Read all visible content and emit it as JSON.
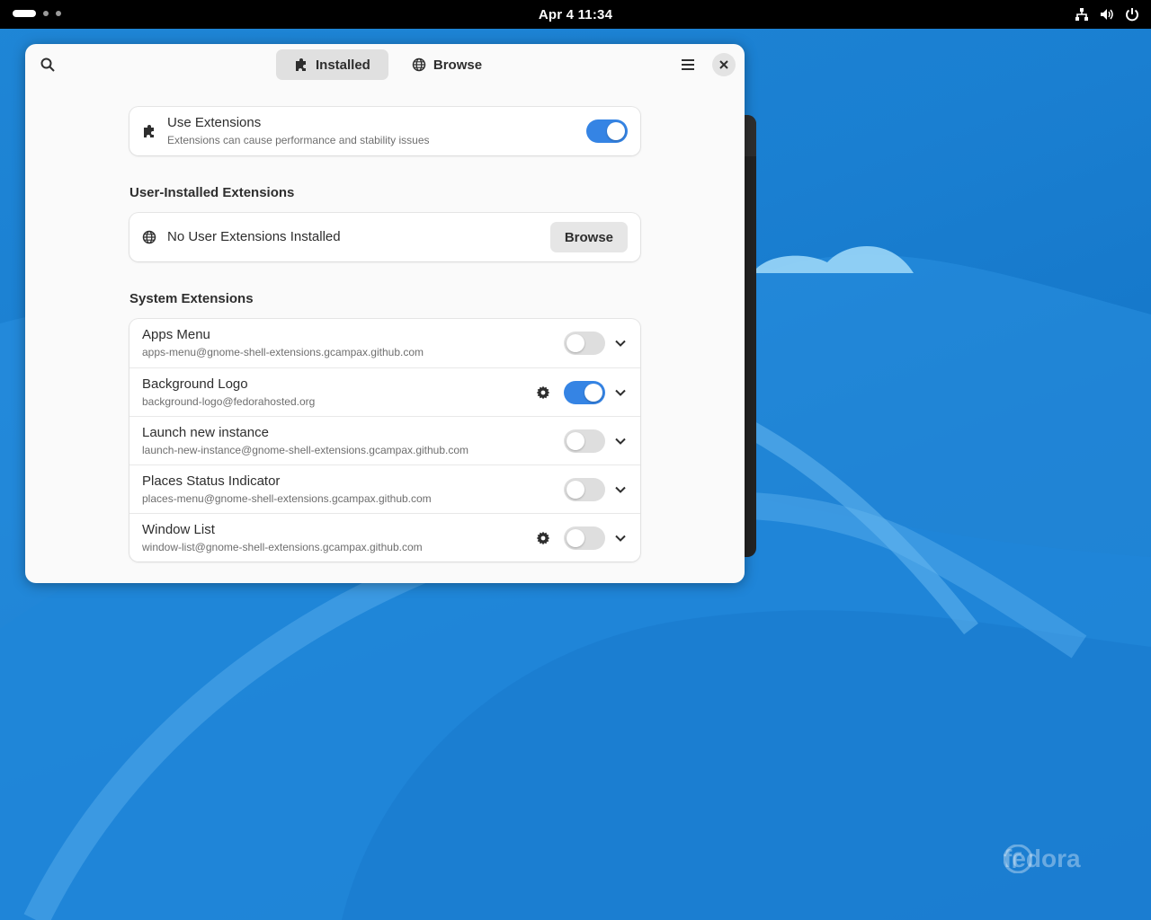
{
  "topbar": {
    "clock": "Apr 4  11:34",
    "tray_icons": [
      "network-wired-icon",
      "volume-icon",
      "power-icon"
    ]
  },
  "window": {
    "tabs": [
      {
        "label": "Installed",
        "icon": "puzzle-icon",
        "active": true
      },
      {
        "label": "Browse",
        "icon": "globe-icon",
        "active": false
      }
    ],
    "use_extensions": {
      "title": "Use Extensions",
      "subtitle": "Extensions can cause performance and stability issues",
      "enabled": true
    },
    "user_section": {
      "heading": "User-Installed Extensions",
      "empty_label": "No User Extensions Installed",
      "browse_label": "Browse"
    },
    "system_section": {
      "heading": "System Extensions",
      "items": [
        {
          "name": "Apps Menu",
          "uuid": "apps-menu@gnome-shell-extensions.gcampax.github.com",
          "enabled": false,
          "has_settings": false
        },
        {
          "name": "Background Logo",
          "uuid": "background-logo@fedorahosted.org",
          "enabled": true,
          "has_settings": true
        },
        {
          "name": "Launch new instance",
          "uuid": "launch-new-instance@gnome-shell-extensions.gcampax.github.com",
          "enabled": false,
          "has_settings": false
        },
        {
          "name": "Places Status Indicator",
          "uuid": "places-menu@gnome-shell-extensions.gcampax.github.com",
          "enabled": false,
          "has_settings": false
        },
        {
          "name": "Window List",
          "uuid": "window-list@gnome-shell-extensions.gcampax.github.com",
          "enabled": false,
          "has_settings": true
        }
      ]
    }
  },
  "desktop": {
    "watermark": "fedora",
    "accent_color": "#3584e4"
  }
}
